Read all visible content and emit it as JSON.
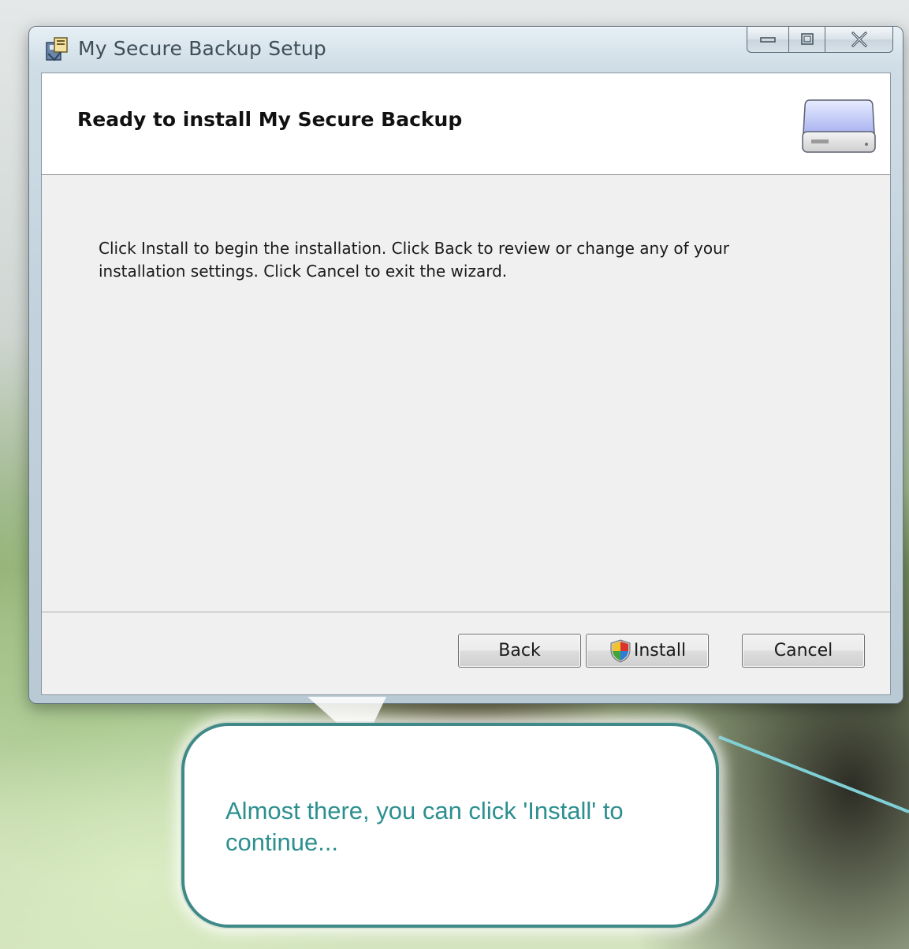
{
  "window": {
    "title": "My Secure Backup Setup",
    "banner_title": "Ready to install My Secure Backup",
    "body_text": "Click Install to begin the installation. Click Back to review or change any of your installation settings. Click Cancel to exit the wizard.",
    "buttons": {
      "back": "Back",
      "install": "Install",
      "cancel": "Cancel"
    }
  },
  "callout": {
    "text": "Almost there, you can click 'Install' to continue..."
  },
  "colors": {
    "callout_text": "#2d8f8f",
    "callout_border": "#3f8a86",
    "window_frame": "#c3d3dd"
  },
  "icons": [
    "app-installer-icon",
    "minimize-icon",
    "maximize-icon",
    "close-icon",
    "drive-icon",
    "uac-shield-icon"
  ]
}
